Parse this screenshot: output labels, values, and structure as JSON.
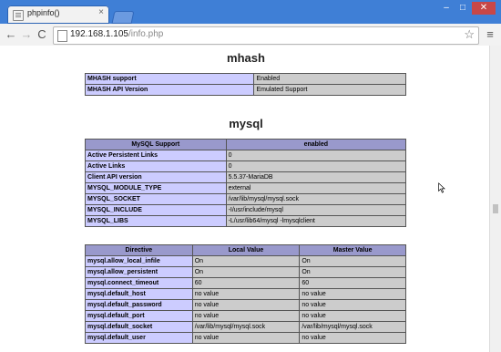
{
  "window": {
    "tab_title": "phpinfo()",
    "tab_close": "×",
    "minimize": "–",
    "maximize": "□",
    "close": "✕"
  },
  "toolbar": {
    "back": "←",
    "forward": "→",
    "reload": "C",
    "url_host": "192.168.1.105",
    "url_path": "/info.php",
    "star": "☆",
    "menu": "≡"
  },
  "mhash": {
    "title": "mhash",
    "rows": [
      [
        "MHASH support",
        "Enabled"
      ],
      [
        "MHASH API Version",
        "Emulated Support"
      ]
    ]
  },
  "mysql": {
    "title": "mysql",
    "support_header": [
      "MySQL Support",
      "enabled"
    ],
    "rows": [
      [
        "Active Persistent Links",
        "0"
      ],
      [
        "Active Links",
        "0"
      ],
      [
        "Client API version",
        "5.5.37-MariaDB"
      ],
      [
        "MYSQL_MODULE_TYPE",
        "external"
      ],
      [
        "MYSQL_SOCKET",
        "/var/lib/mysql/mysql.sock"
      ],
      [
        "MYSQL_INCLUDE",
        "-I/usr/include/mysql"
      ],
      [
        "MYSQL_LIBS",
        "-L/usr/lib64/mysql -lmysqlclient"
      ]
    ],
    "directive_header": [
      "Directive",
      "Local Value",
      "Master Value"
    ],
    "directives": [
      [
        "mysql.allow_local_infile",
        "On",
        "On"
      ],
      [
        "mysql.allow_persistent",
        "On",
        "On"
      ],
      [
        "mysql.connect_timeout",
        "60",
        "60"
      ],
      [
        "mysql.default_host",
        "no value",
        "no value"
      ],
      [
        "mysql.default_password",
        "no value",
        "no value"
      ],
      [
        "mysql.default_port",
        "no value",
        "no value"
      ],
      [
        "mysql.default_socket",
        "/var/lib/mysql/mysql.sock",
        "/var/lib/mysql/mysql.sock"
      ],
      [
        "mysql.default_user",
        "no value",
        "no value"
      ]
    ]
  }
}
